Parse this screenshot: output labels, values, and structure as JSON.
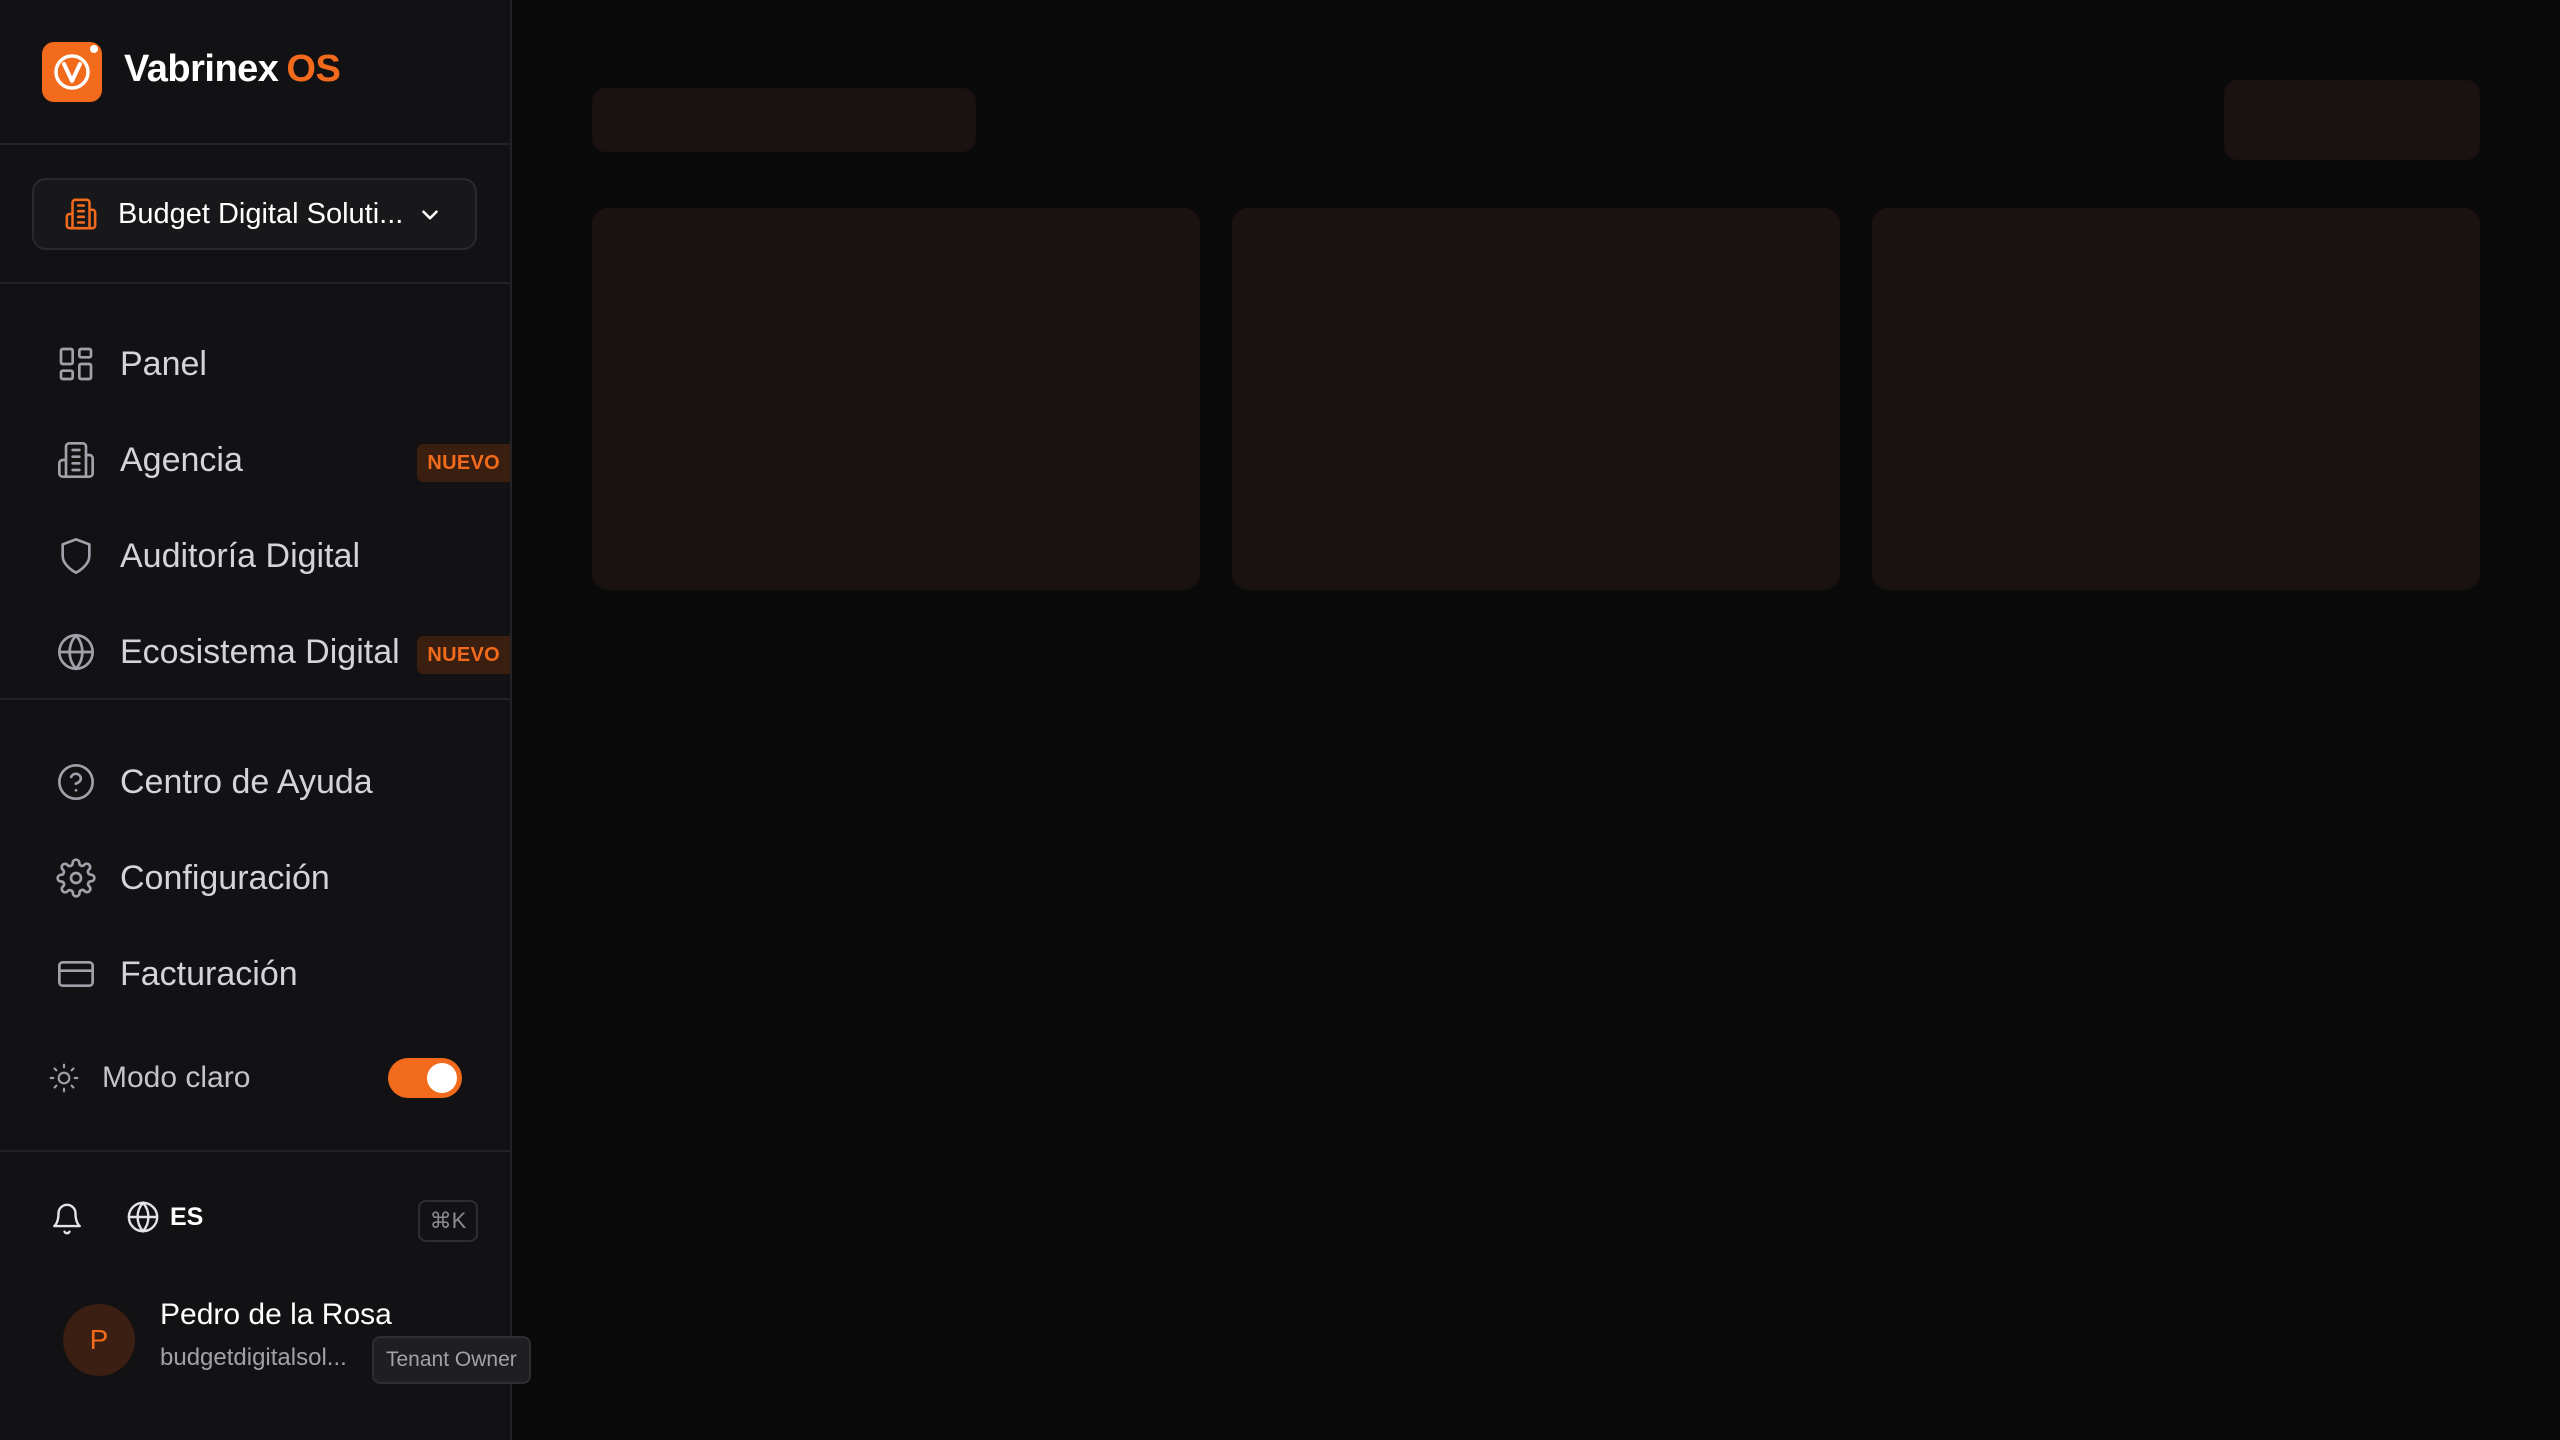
{
  "brand": {
    "name": "Vabrinex",
    "suffix": "OS",
    "accent_color": "#f26a1b"
  },
  "tenant": {
    "label": "Budget Digital Soluti...",
    "icon": "building-icon"
  },
  "nav": [
    {
      "label": "Panel",
      "icon": "dashboard-icon",
      "badge": ""
    },
    {
      "label": "Agencia",
      "icon": "building-icon",
      "badge": "NUEVO"
    },
    {
      "label": "Auditoría Digital",
      "icon": "shield-icon",
      "badge": ""
    },
    {
      "label": "Ecosistema Digital",
      "icon": "globe-icon",
      "badge": "NUEVO"
    }
  ],
  "nav_secondary": [
    {
      "label": "Centro de Ayuda",
      "icon": "help-circle-icon"
    },
    {
      "label": "Configuración",
      "icon": "gear-icon"
    },
    {
      "label": "Facturación",
      "icon": "credit-card-icon"
    }
  ],
  "theme": {
    "label": "Modo claro",
    "enabled": true
  },
  "tools": {
    "language": "ES",
    "shortcut": "⌘K"
  },
  "user": {
    "initial": "P",
    "name": "Pedro de la Rosa",
    "email": "budgetdigitalsol...",
    "role": "Tenant Owner"
  },
  "main": {
    "loading": true,
    "skeleton_cards": 3
  }
}
